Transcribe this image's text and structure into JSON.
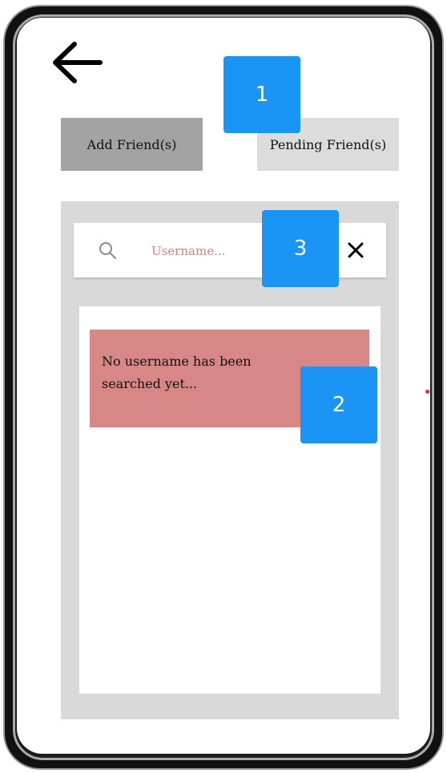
{
  "tabs": {
    "add_friends_label": "Add Friend(s)",
    "pending_friends_label": "Pending Friend(s)"
  },
  "search": {
    "placeholder": "Username..."
  },
  "results": {
    "empty_message": "No username has been searched yet..."
  },
  "annotations": {
    "badge_1": "1",
    "badge_2": "2",
    "badge_3": "3"
  },
  "icons": {
    "back": "arrow-left-icon",
    "search": "magnifier-icon",
    "clear": "x-close-icon"
  },
  "colors": {
    "add_tab": "#a3a3a3",
    "pending_tab": "#dcdcdc",
    "message_card": "#d88787",
    "placeholder_text": "#d88080",
    "badge": "#1a94f5"
  }
}
